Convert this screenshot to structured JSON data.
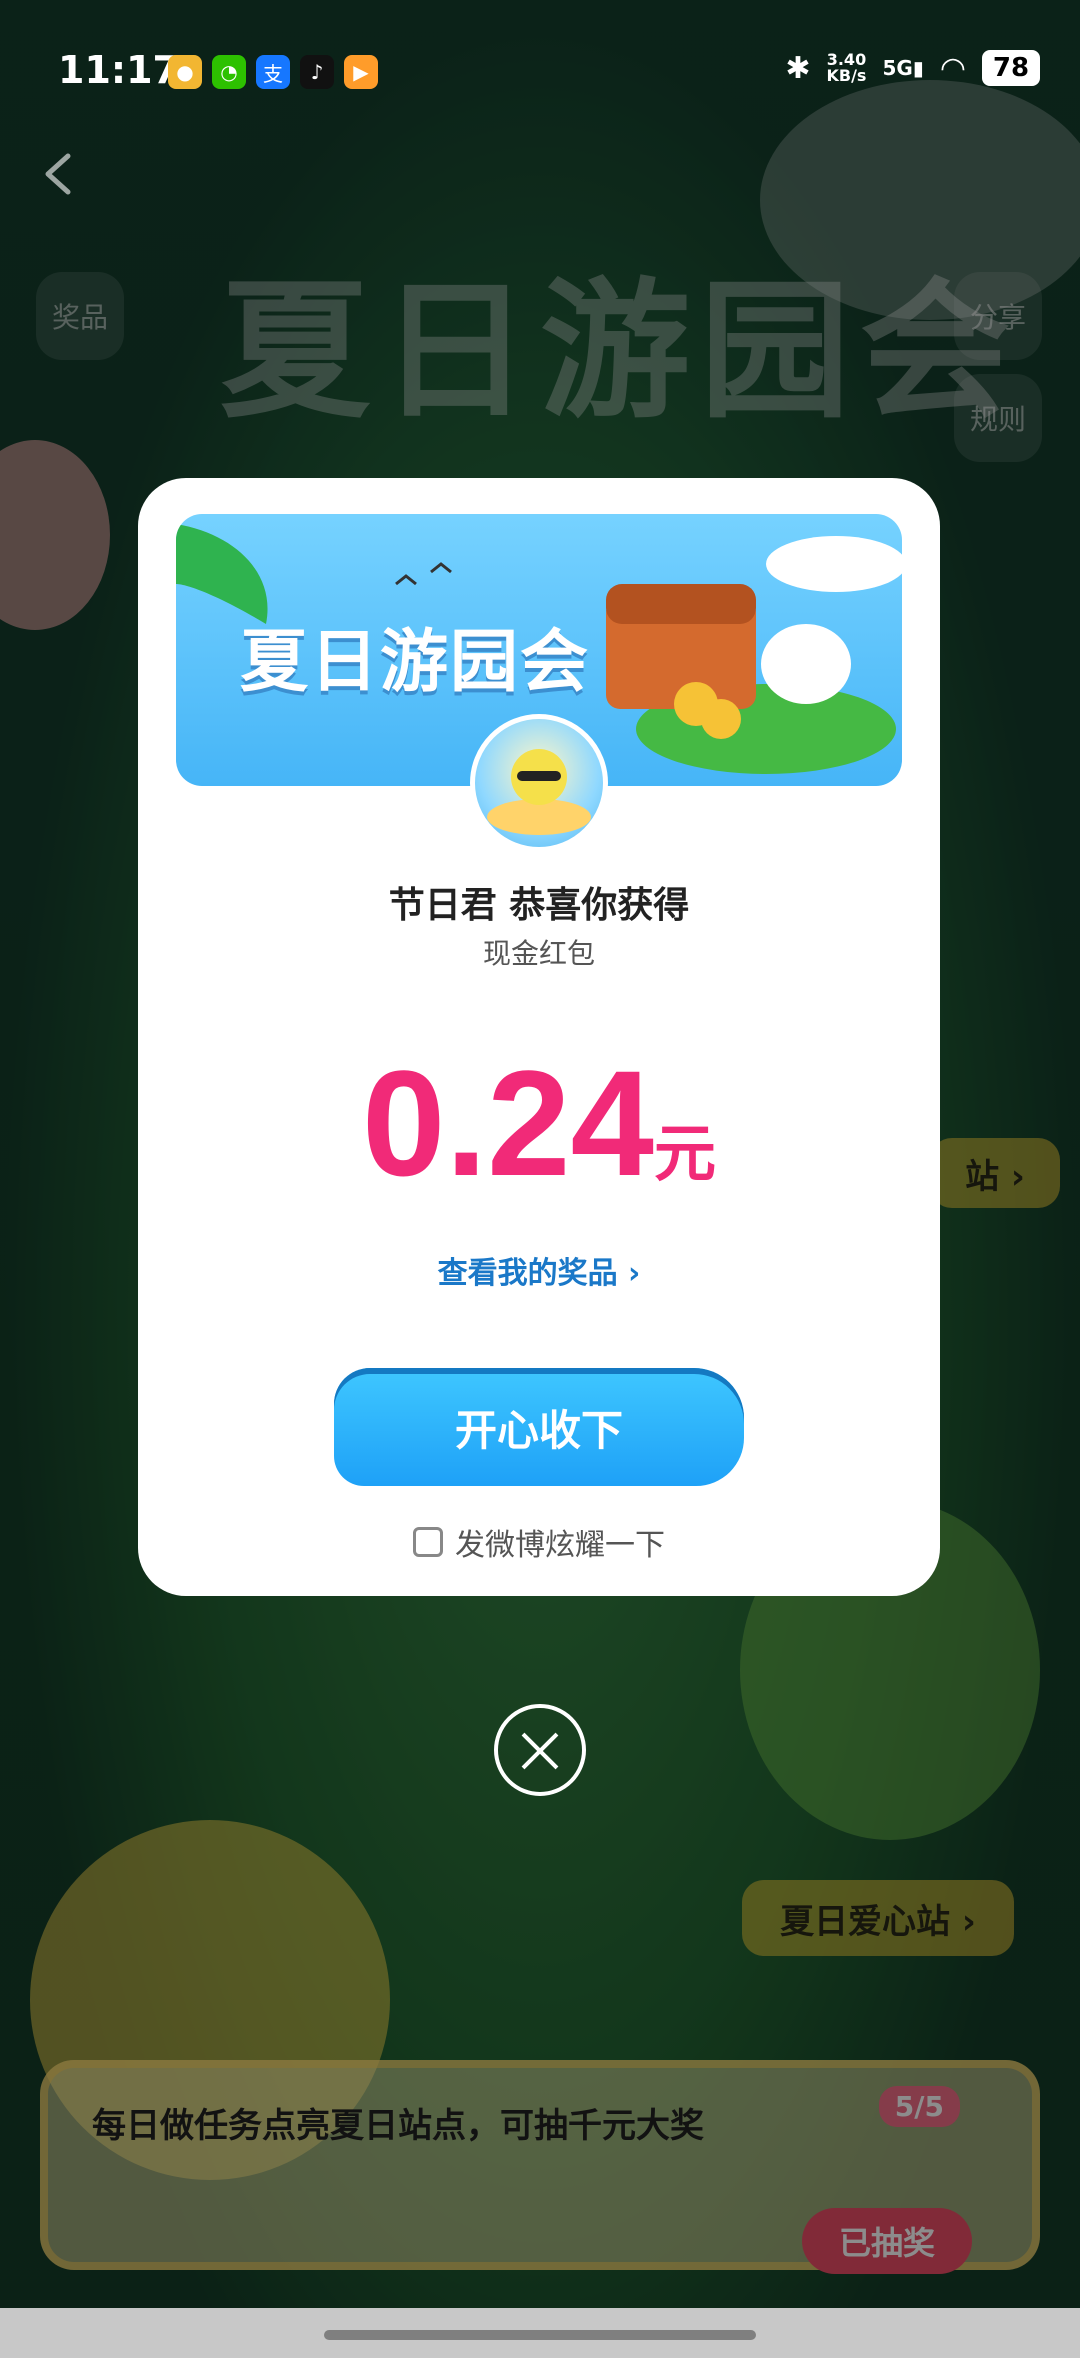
{
  "status_bar": {
    "time": "11:17",
    "network_speed": "3.40",
    "network_unit": "KB/s",
    "signal": "5G",
    "battery": "78"
  },
  "background": {
    "title": "夏日游园会",
    "left_pill": "奖品",
    "right_pill_1": "分享",
    "right_pill_2": "规则",
    "station_1": "站 ›",
    "station_2": "夏日爱心站 ›"
  },
  "modal": {
    "banner_title": "夏日游园会",
    "title": "节日君 恭喜你获得",
    "subtitle": "现金红包",
    "amount": "0.24",
    "amount_unit": "元",
    "view_prizes": "查看我的奖品 ›",
    "primary_button": "开心收下",
    "share_option": "发微博炫耀一下"
  },
  "task_panel": {
    "text": "每日做任务点亮夏日站点，可抽千元大奖",
    "count": "5/5",
    "button": "已抽奖"
  }
}
